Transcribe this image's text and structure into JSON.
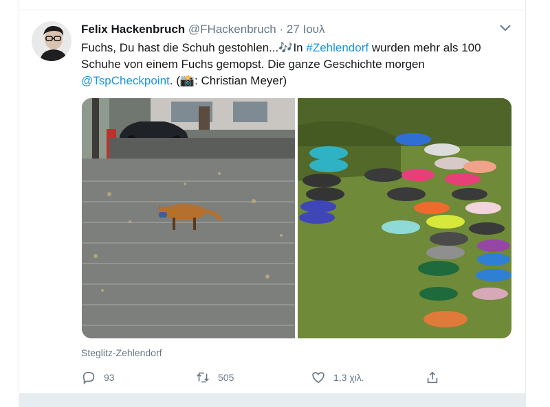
{
  "tweet": {
    "author_name": "Felix Hackenbruch",
    "handle": "@FHackenbruch",
    "separator": "·",
    "date": "27 Ιουλ",
    "text_segments": [
      {
        "text": "Fuchs, Du hast die Schuh gestohlen...🎶In ",
        "link": false
      },
      {
        "text": "#Zehlendorf",
        "link": true
      },
      {
        "text": " wurden mehr als 100 Schuhe von einem Fuchs gemopst. Die ganze Geschichte morgen ",
        "link": false
      },
      {
        "text": "@TspCheckpoint",
        "link": true
      },
      {
        "text": ". (📸: Christian Meyer)",
        "link": false
      }
    ],
    "location": "Steglitz-Zehlendorf",
    "actions": {
      "replies": "93",
      "retweets": "505",
      "likes": "1,3 χιλ."
    }
  },
  "icons": [
    "avatar",
    "chevron-down-icon",
    "reply-icon",
    "retweet-icon",
    "like-icon",
    "share-icon"
  ],
  "colors": {
    "link": "#1b95e0",
    "secondary_text": "#657786",
    "border": "#e6ecf0"
  }
}
